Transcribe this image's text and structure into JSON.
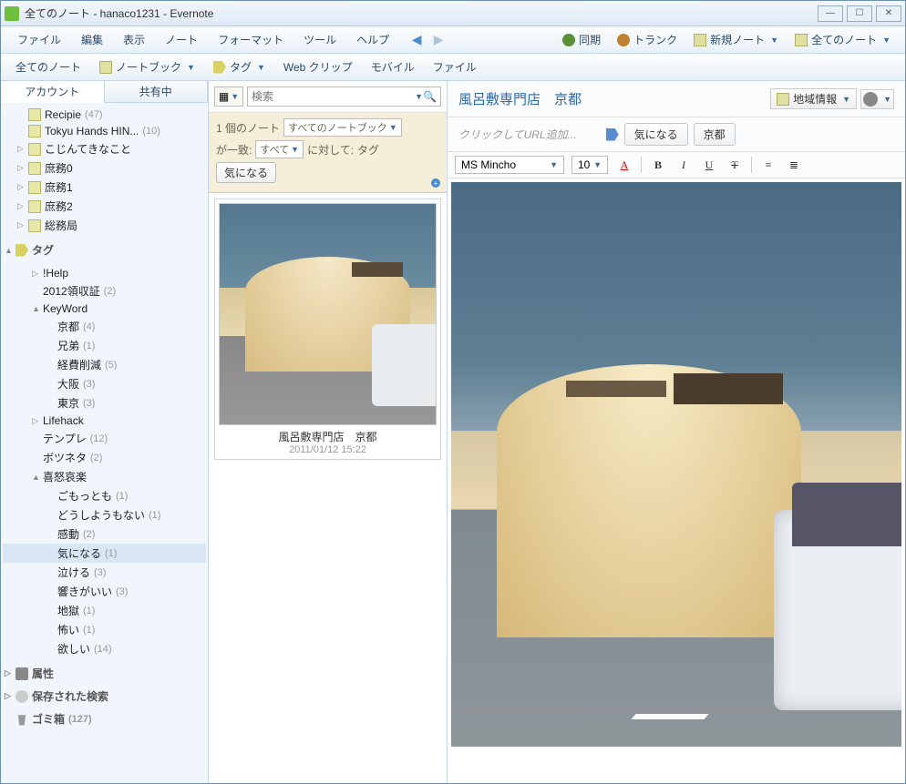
{
  "window_title": "全てのノート - hanaco1231 - Evernote",
  "menu": [
    "ファイル",
    "編集",
    "表示",
    "ノート",
    "フォーマット",
    "ツール",
    "ヘルプ"
  ],
  "toolbar": {
    "sync": "同期",
    "trunk": "トランク",
    "new_note": "新規ノート",
    "all_notes": "全てのノート"
  },
  "toolbar2": {
    "all_notes": "全てのノート",
    "notebook": "ノートブック",
    "tag": "タグ",
    "web_clip": "Web クリップ",
    "mobile": "モバイル",
    "file": "ファイル"
  },
  "sidebar": {
    "tabs": {
      "account": "アカウント",
      "shared": "共有中"
    },
    "notebooks": [
      {
        "label": "Recipie",
        "count": "(47)"
      },
      {
        "label": "Tokyu Hands HIN...",
        "count": "(10)"
      },
      {
        "label": "こじんてきなこと",
        "count": ""
      },
      {
        "label": "庶務0",
        "count": ""
      },
      {
        "label": "庶務1",
        "count": ""
      },
      {
        "label": "庶務2",
        "count": ""
      },
      {
        "label": "総務局",
        "count": ""
      }
    ],
    "tags_header": "タグ",
    "tags": [
      {
        "label": "!Help",
        "count": "",
        "indent": 1,
        "arrow": "▷"
      },
      {
        "label": "2012領収証",
        "count": "(2)",
        "indent": 1,
        "arrow": ""
      },
      {
        "label": "KeyWord",
        "count": "",
        "indent": 1,
        "arrow": "▲"
      },
      {
        "label": "京都",
        "count": "(4)",
        "indent": 2,
        "arrow": ""
      },
      {
        "label": "兄弟",
        "count": "(1)",
        "indent": 2,
        "arrow": ""
      },
      {
        "label": "経費削減",
        "count": "(5)",
        "indent": 2,
        "arrow": ""
      },
      {
        "label": "大阪",
        "count": "(3)",
        "indent": 2,
        "arrow": ""
      },
      {
        "label": "東京",
        "count": "(3)",
        "indent": 2,
        "arrow": ""
      },
      {
        "label": "Lifehack",
        "count": "",
        "indent": 1,
        "arrow": "▷"
      },
      {
        "label": "テンプレ",
        "count": "(12)",
        "indent": 1,
        "arrow": ""
      },
      {
        "label": "ボツネタ",
        "count": "(2)",
        "indent": 1,
        "arrow": ""
      },
      {
        "label": "喜怒哀楽",
        "count": "",
        "indent": 1,
        "arrow": "▲"
      },
      {
        "label": "ごもっとも",
        "count": "(1)",
        "indent": 2,
        "arrow": ""
      },
      {
        "label": "どうしようもない",
        "count": "(1)",
        "indent": 2,
        "arrow": ""
      },
      {
        "label": "感動",
        "count": "(2)",
        "indent": 2,
        "arrow": ""
      },
      {
        "label": "気になる",
        "count": "(1)",
        "indent": 2,
        "arrow": "",
        "selected": true
      },
      {
        "label": "泣ける",
        "count": "(3)",
        "indent": 2,
        "arrow": ""
      },
      {
        "label": "響きがいい",
        "count": "(3)",
        "indent": 2,
        "arrow": ""
      },
      {
        "label": "地獄",
        "count": "(1)",
        "indent": 2,
        "arrow": ""
      },
      {
        "label": "怖い",
        "count": "(1)",
        "indent": 2,
        "arrow": ""
      },
      {
        "label": "欲しい",
        "count": "(14)",
        "indent": 2,
        "arrow": ""
      }
    ],
    "attributes": "属性",
    "saved_search": "保存された検索",
    "trash": {
      "label": "ゴミ箱",
      "count": "(127)"
    }
  },
  "middle": {
    "search_placeholder": "検索",
    "filter": {
      "count_text": "1 個のノート",
      "notebook_sel": "すべてのノートブック",
      "match_label": "が一致:",
      "match_sel": "すべて",
      "against_label": "に対して:",
      "against_value": "タグ",
      "chip": "気になる"
    },
    "note": {
      "title": "風呂敷専門店　京都",
      "date": "2011/01/12 15:22"
    }
  },
  "detail": {
    "title": "風呂敷専門店　京都",
    "notebook_btn": "地域情報",
    "url_placeholder": "クリックしてURL追加...",
    "tags": [
      "気になる",
      "京都"
    ],
    "font": "MS Mincho",
    "font_size": "10"
  }
}
